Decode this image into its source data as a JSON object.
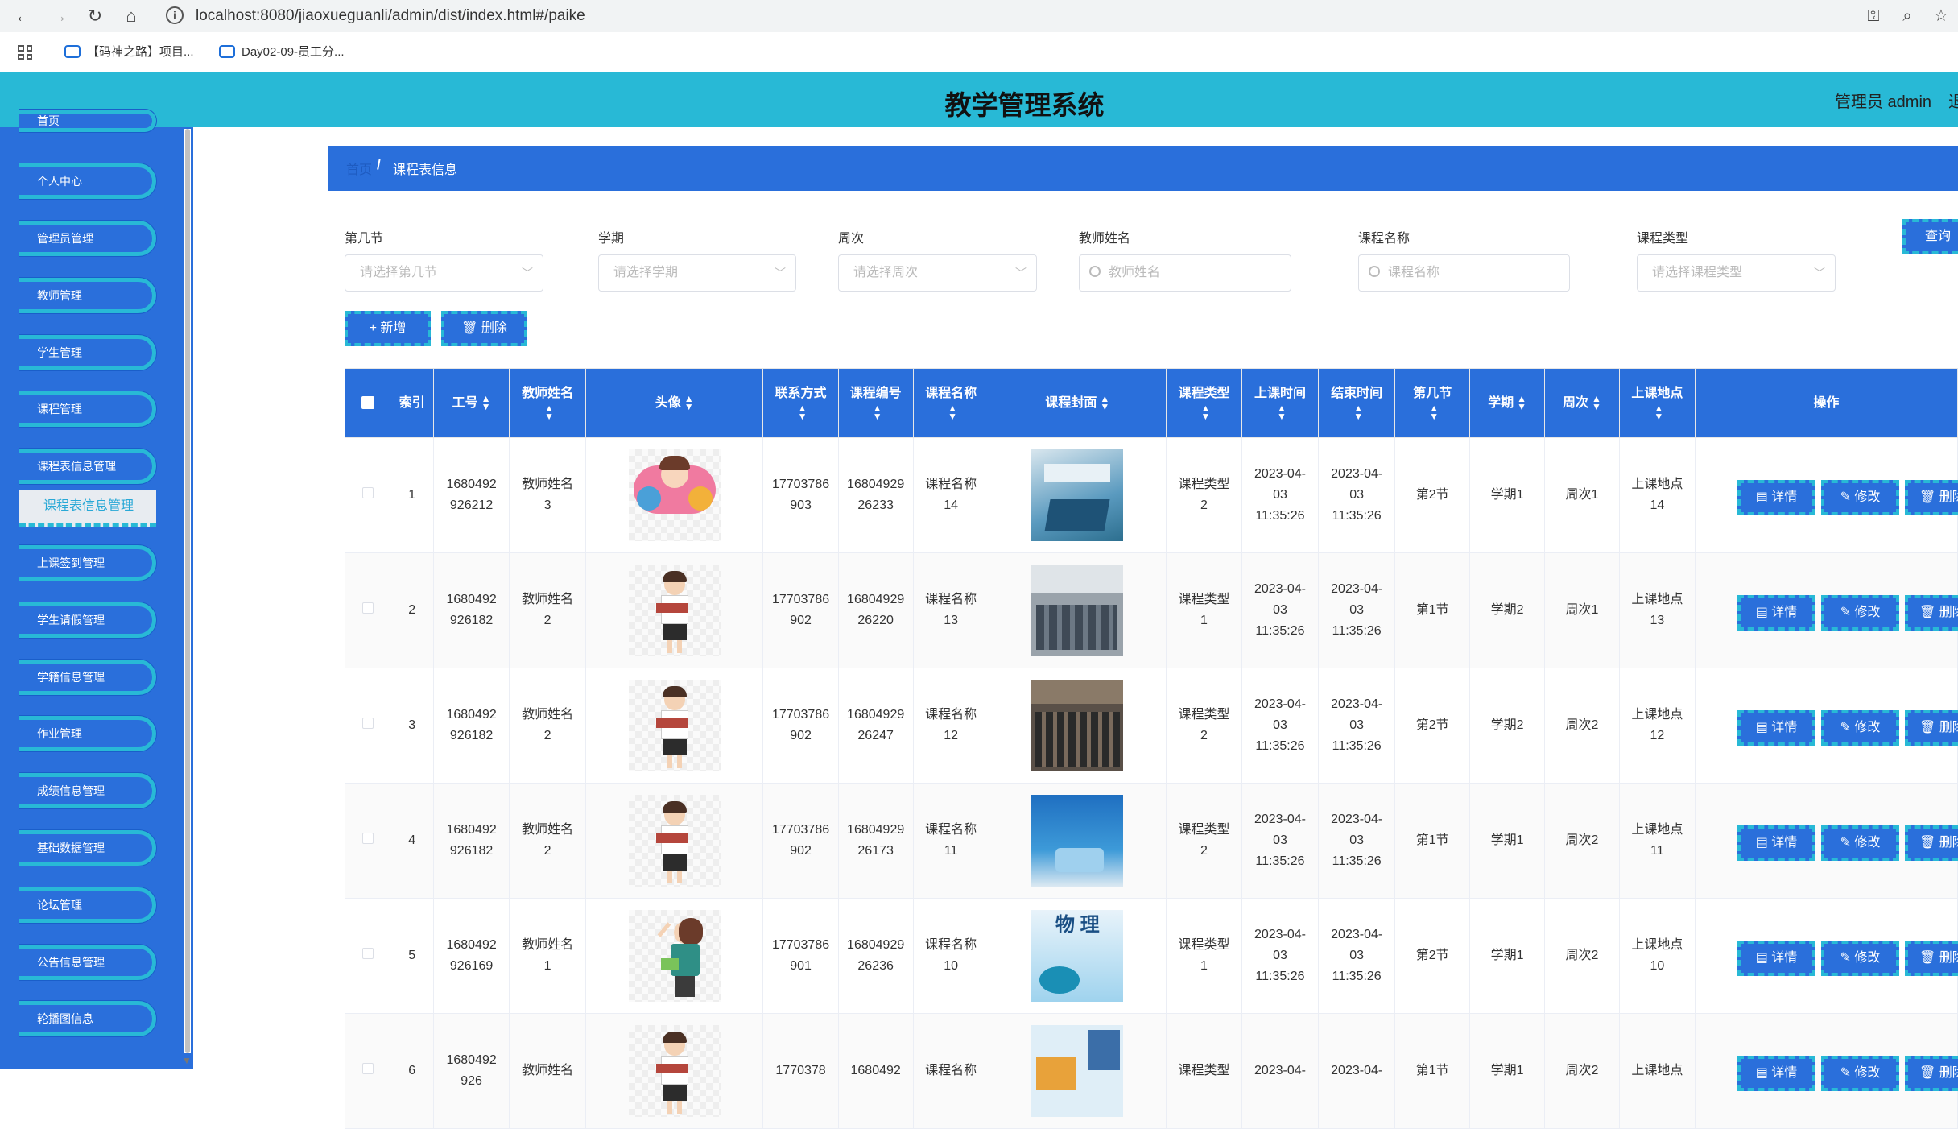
{
  "browser": {
    "url": "localhost:8080/jiaoxueguanli/admin/dist/index.html#/paike",
    "bookmarks": [
      "【码神之路】项目...",
      "Day02-09-员工分..."
    ]
  },
  "header": {
    "title": "教学管理系统",
    "user": "管理员 admin",
    "exit": "退"
  },
  "sidebar": {
    "top_partial": "首页",
    "items": [
      {
        "label": "个人中心"
      },
      {
        "label": "管理员管理"
      },
      {
        "label": "教师管理"
      },
      {
        "label": "学生管理"
      },
      {
        "label": "课程管理"
      },
      {
        "label": "课程表信息管理"
      },
      {
        "label": "上课签到管理"
      },
      {
        "label": "学生请假管理"
      },
      {
        "label": "学籍信息管理"
      },
      {
        "label": "作业管理"
      },
      {
        "label": "成绩信息管理"
      },
      {
        "label": "基础数据管理"
      },
      {
        "label": "论坛管理"
      },
      {
        "label": "公告信息管理"
      },
      {
        "label": "轮播图信息"
      }
    ],
    "submenu_active": "课程表信息管理"
  },
  "breadcrumb": {
    "home": "首页",
    "sep": "/",
    "current": "课程表信息"
  },
  "filters": {
    "f1": {
      "label": "第几节",
      "placeholder": "请选择第几节"
    },
    "f2": {
      "label": "学期",
      "placeholder": "请选择学期"
    },
    "f3": {
      "label": "周次",
      "placeholder": "请选择周次"
    },
    "f4": {
      "label": "教师姓名",
      "placeholder": "教师姓名"
    },
    "f5": {
      "label": "课程名称",
      "placeholder": "课程名称"
    },
    "f6": {
      "label": "课程类型",
      "placeholder": "请选择课程类型"
    },
    "query_label": "查询"
  },
  "toolbar": {
    "add_label": "+ 新增",
    "delete_label": "🗑 删除"
  },
  "table": {
    "headers": [
      "索引",
      "工号",
      "教师姓名",
      "头像",
      "联系方式",
      "课程编号",
      "课程名称",
      "课程封面",
      "课程类型",
      "上课时间",
      "结束时间",
      "第几节",
      "学期",
      "周次",
      "上课地点",
      "操作"
    ],
    "actions": {
      "detail": "详情",
      "edit": "修改",
      "delete": "删除"
    },
    "rows": [
      {
        "idx": "1",
        "gonghao": "1680492926212",
        "teacher": "教师姓名3",
        "phone": "17703786903",
        "code": "1680492926233",
        "name": "课程名称14",
        "type": "课程类型2",
        "start": "2023-04-03 11:35:26",
        "end": "2023-04-03 11:35:26",
        "jie": "第2节",
        "term": "学期1",
        "week": "周次1",
        "place": "上课地点14"
      },
      {
        "idx": "2",
        "gonghao": "1680492926182",
        "teacher": "教师姓名2",
        "phone": "17703786902",
        "code": "1680492926220",
        "name": "课程名称13",
        "type": "课程类型1",
        "start": "2023-04-03 11:35:26",
        "end": "2023-04-03 11:35:26",
        "jie": "第1节",
        "term": "学期2",
        "week": "周次1",
        "place": "上课地点13"
      },
      {
        "idx": "3",
        "gonghao": "1680492926182",
        "teacher": "教师姓名2",
        "phone": "17703786902",
        "code": "1680492926247",
        "name": "课程名称12",
        "type": "课程类型2",
        "start": "2023-04-03 11:35:26",
        "end": "2023-04-03 11:35:26",
        "jie": "第2节",
        "term": "学期2",
        "week": "周次2",
        "place": "上课地点12"
      },
      {
        "idx": "4",
        "gonghao": "1680492926182",
        "teacher": "教师姓名2",
        "phone": "17703786902",
        "code": "1680492926173",
        "name": "课程名称11",
        "type": "课程类型2",
        "start": "2023-04-03 11:35:26",
        "end": "2023-04-03 11:35:26",
        "jie": "第1节",
        "term": "学期1",
        "week": "周次2",
        "place": "上课地点11"
      },
      {
        "idx": "5",
        "gonghao": "1680492926169",
        "teacher": "教师姓名1",
        "phone": "17703786901",
        "code": "1680492926236",
        "name": "课程名称10",
        "type": "课程类型1",
        "start": "2023-04-03 11:35:26",
        "end": "2023-04-03 11:35:26",
        "jie": "第2节",
        "term": "学期1",
        "week": "周次2",
        "place": "上课地点10"
      },
      {
        "idx": "6",
        "gonghao": "1680492926",
        "teacher": "教师姓名",
        "phone": "1770378",
        "code": "1680492",
        "name": "课程名称",
        "type": "课程类型",
        "start": "2023-04-",
        "end": "2023-04-",
        "jie": "第1节",
        "term": "学期1",
        "week": "周次2",
        "place": "上课地点"
      }
    ]
  },
  "colors": {
    "brand": "#2a6fdb",
    "accent": "#28b9d6"
  }
}
